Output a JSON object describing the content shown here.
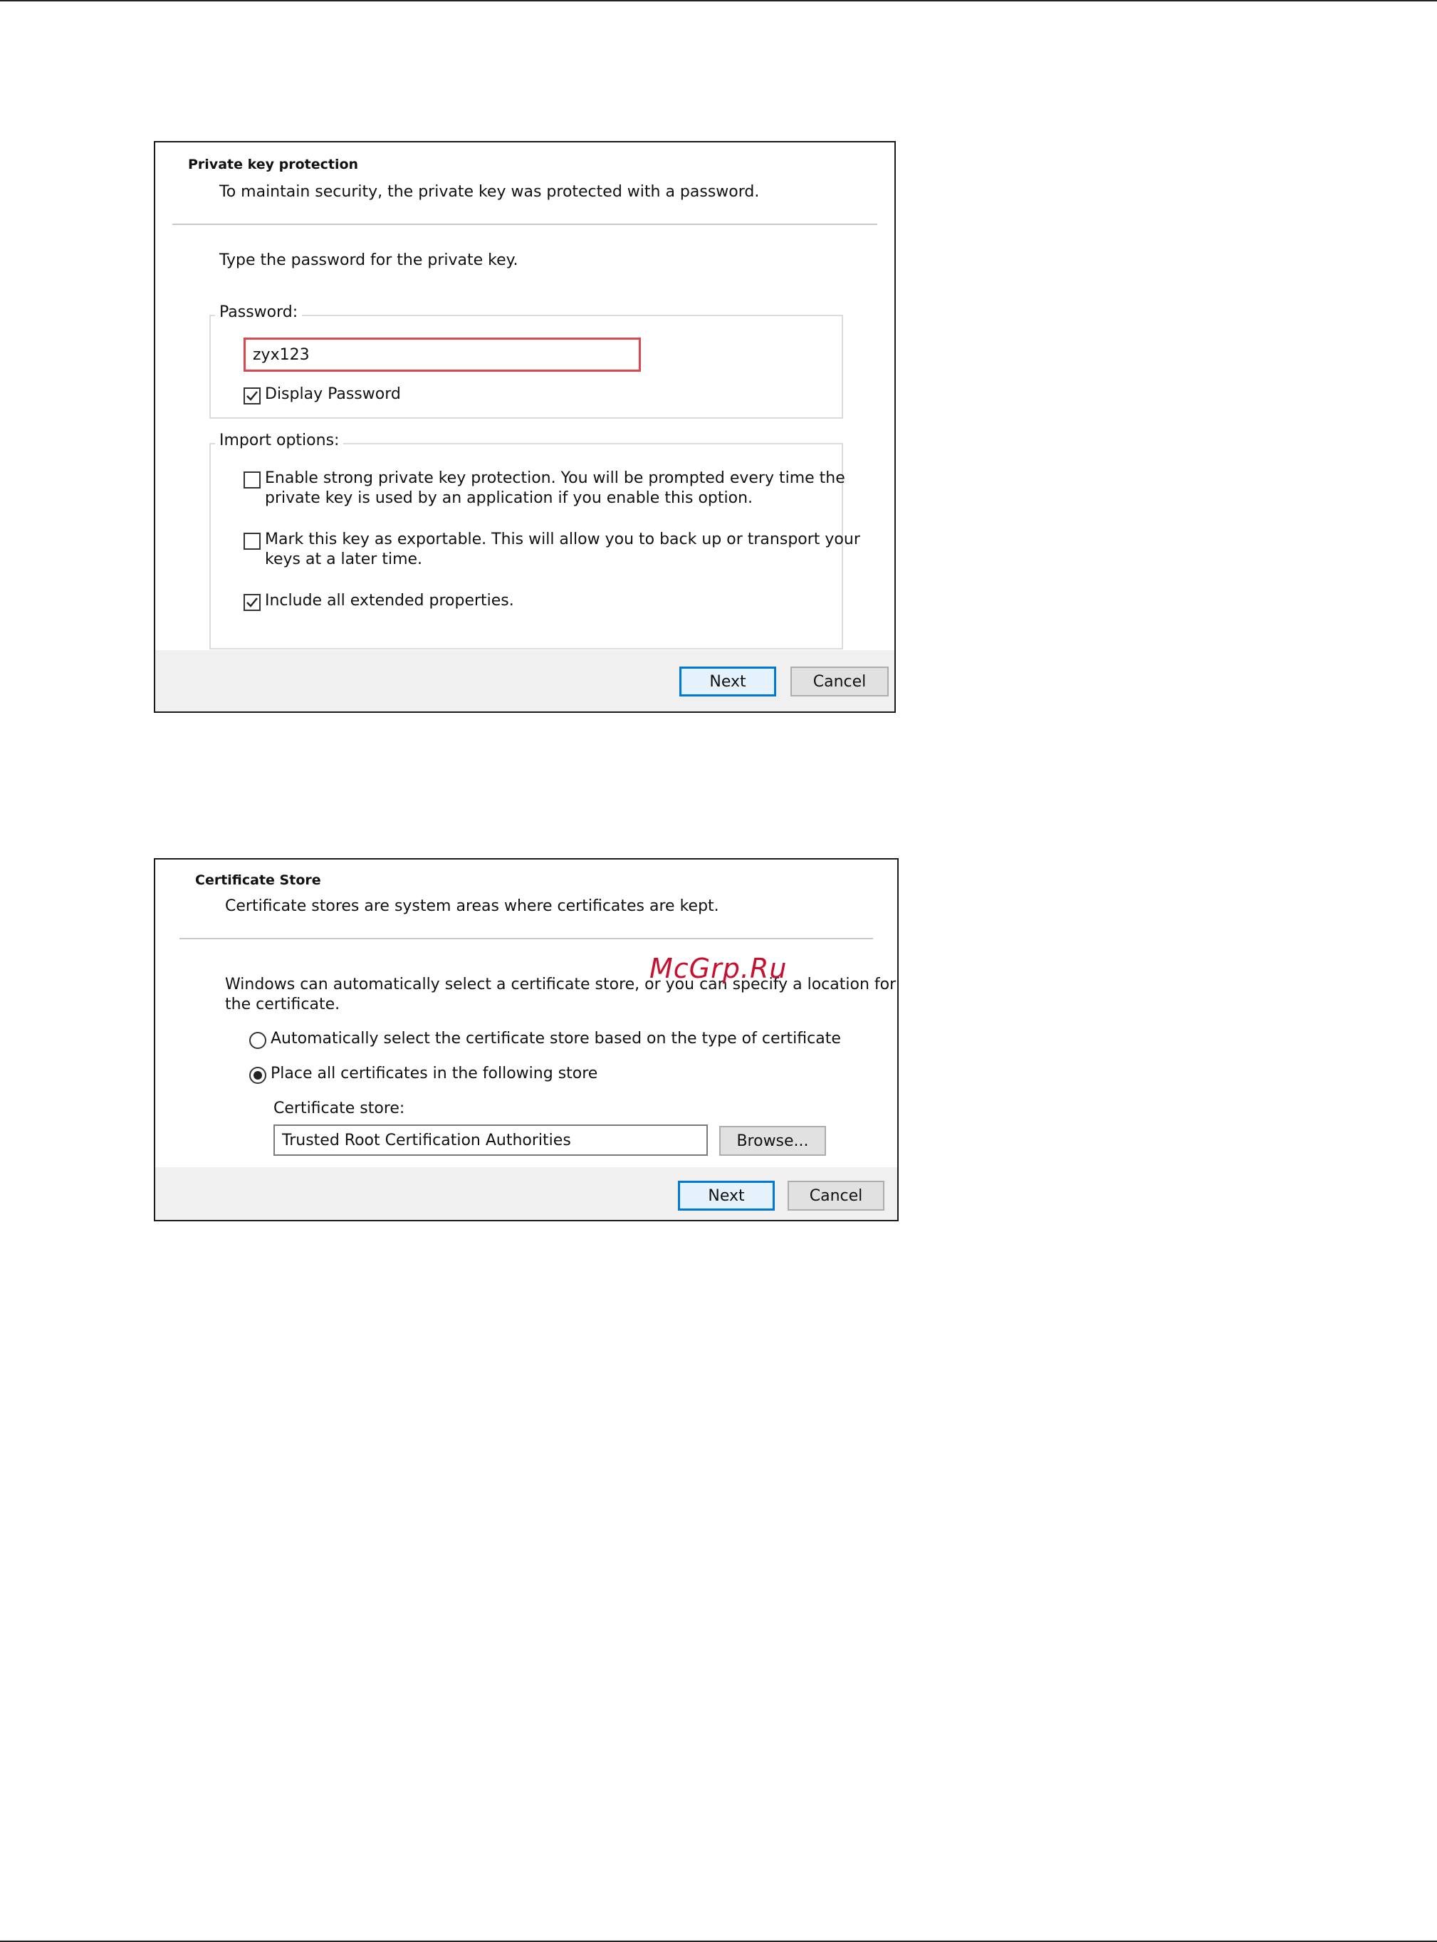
{
  "dialog1": {
    "heading": "Private key protection",
    "subheading": "To maintain security, the private key was protected with a password.",
    "prompt": "Type the password for the private key.",
    "password_group_label": "Password:",
    "password_value": "zyx123",
    "display_password": {
      "label": "Display Password",
      "checked": true
    },
    "import_options_label": "Import options:",
    "options": [
      {
        "line1": "Enable strong private key protection. You will be prompted every time the",
        "line2": "private key is used by an application if you enable this option.",
        "checked": false
      },
      {
        "line1": "Mark this key as exportable. This will allow you to back up or transport your",
        "line2": "keys at a later time.",
        "checked": false
      },
      {
        "line1": "Include all extended properties.",
        "line2": "",
        "checked": true
      }
    ],
    "next_label": "Next",
    "cancel_label": "Cancel"
  },
  "dialog2": {
    "heading": "Certificate Store",
    "subheading": "Certificate stores are system areas where certificates are kept.",
    "description_line1": "Windows can automatically select a certificate store, or you can specify a location for",
    "description_line2": "the certificate.",
    "radio_auto": {
      "label": "Automatically select the certificate store based on the type of certificate",
      "selected": false
    },
    "radio_place": {
      "label": "Place all certificates in the following store",
      "selected": true
    },
    "store_label": "Certificate store:",
    "store_value": "Trusted Root Certification Authorities",
    "browse_label": "Browse...",
    "next_label": "Next",
    "cancel_label": "Cancel"
  },
  "watermark": "McGrp.Ru",
  "colors": {
    "accent": "#0078d7",
    "highlight": "#e0464f",
    "footer": "#f0f0f0",
    "watermark": "#c8102e"
  },
  "icons": {
    "check": "check-icon",
    "radio_dot": "radio-dot-icon"
  }
}
